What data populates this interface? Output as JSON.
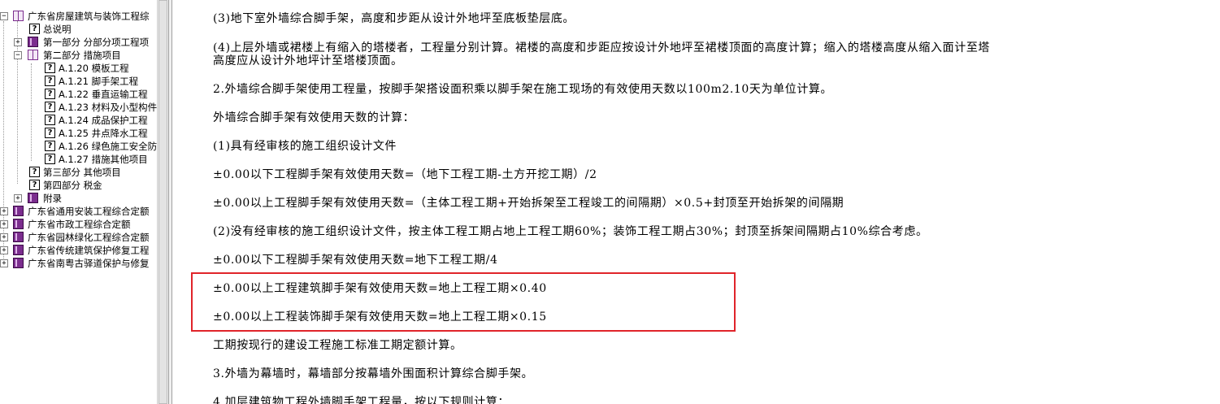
{
  "tree": {
    "items": [
      {
        "label": "广东省房屋建筑与装饰工程综",
        "expander": "−",
        "icon": "open-book"
      },
      {
        "label": "总说明",
        "icon": "help"
      },
      {
        "label": "第一部分 分部分项工程项",
        "expander": "+",
        "icon": "book"
      },
      {
        "label": "第二部分 措施项目",
        "expander": "−",
        "icon": "open-book"
      },
      {
        "label": "A.1.20 模板工程",
        "icon": "help"
      },
      {
        "label": "A.1.21 脚手架工程",
        "icon": "help"
      },
      {
        "label": "A.1.22 垂直运输工程",
        "icon": "help"
      },
      {
        "label": "A.1.23 材料及小型构件",
        "icon": "help"
      },
      {
        "label": "A.1.24 成品保护工程",
        "icon": "help"
      },
      {
        "label": "A.1.25 井点降水工程",
        "icon": "help"
      },
      {
        "label": "A.1.26 绿色施工安全防",
        "icon": "help"
      },
      {
        "label": "A.1.27 措施其他项目",
        "icon": "help"
      },
      {
        "label": "第三部分 其他项目",
        "icon": "help"
      },
      {
        "label": "第四部分 税金",
        "icon": "help"
      },
      {
        "label": "附录",
        "expander": "+",
        "icon": "book"
      },
      {
        "label": "广东省通用安装工程综合定额",
        "expander": "+",
        "icon": "book"
      },
      {
        "label": "广东省市政工程综合定额",
        "expander": "+",
        "icon": "book"
      },
      {
        "label": "广东省园林绿化工程综合定额",
        "expander": "+",
        "icon": "book"
      },
      {
        "label": "广东省传统建筑保护修复工程",
        "expander": "+",
        "icon": "book"
      },
      {
        "label": "广东省南粤古驿道保护与修复",
        "expander": "+",
        "icon": "book"
      }
    ]
  },
  "content": {
    "lines": [
      "(3)地下室外墙综合脚手架，高度和步距从设计外地坪至底板垫层底。",
      "(4)上层外墙或裙楼上有缩入的塔楼者，工程量分别计算。裙楼的高度和步距应按设计外地坪至裙楼顶面的高度计算；缩入的塔楼高度从缩入面计至塔",
      "高度应从设计外地坪计至塔楼顶面。",
      "2.外墙综合脚手架使用工程量，按脚手架搭设面积乘以脚手架在施工现场的有效使用天数以100m2.10天为单位计算。",
      "外墙综合脚手架有效使用天数的计算：",
      "(1)具有经审核的施工组织设计文件",
      "±0.00以下工程脚手架有效使用天数=（地下工程工期-土方开挖工期）/2",
      "±0.00以上工程脚手架有效使用天数=（主体工程工期+开始拆架至工程竣工的间隔期）×0.5+封顶至开始拆架的间隔期",
      "(2)没有经审核的施工组织设计文件，按主体工程工期占地上工程工期60%；装饰工程工期占30%；封顶至拆架间隔期占10%综合考虑。",
      "±0.00以下工程脚手架有效使用天数=地下工程工期/4",
      "±0.00以上工程建筑脚手架有效使用天数=地上工程工期×0.40",
      "±0.00以上工程装饰脚手架有效使用天数=地上工程工期×0.15",
      "工期按现行的建设工程施工标准工期定额计算。",
      "3.外墙为幕墙时，幕墙部分按幕墙外围面积计算综合脚手架。",
      "4.加层建筑物工程外墙脚手架工程量，按以下规则计算："
    ]
  }
}
